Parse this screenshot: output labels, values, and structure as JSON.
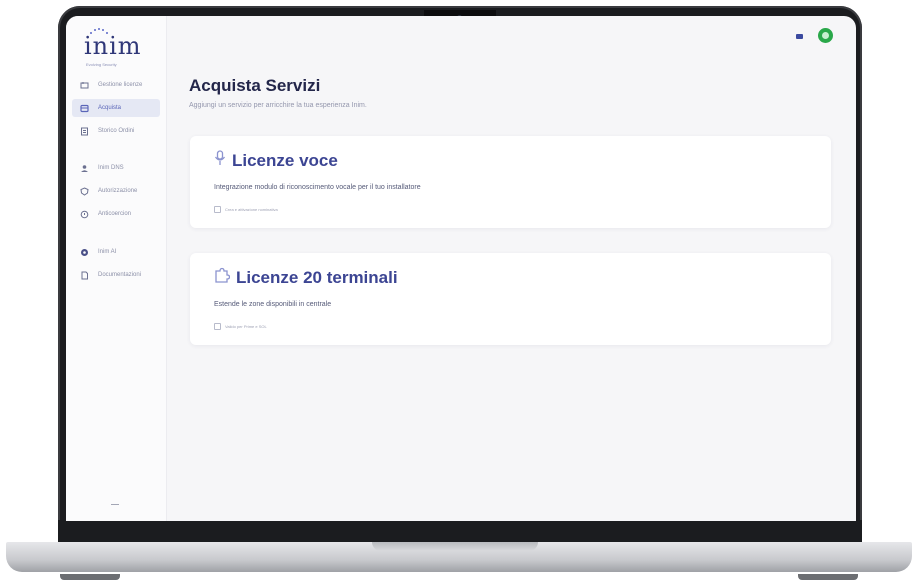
{
  "app": {
    "logo": "inim",
    "logo_tagline": "Evolving Security"
  },
  "sidebar": {
    "items": [
      {
        "label": "Gestione licenze",
        "icon": "license-icon",
        "active": false
      },
      {
        "label": "Acquista",
        "icon": "cart-icon",
        "active": true
      },
      {
        "label": "Storico Ordini",
        "icon": "orders-icon",
        "active": false
      },
      {
        "label": "Inim DNS",
        "icon": "users-icon",
        "active": false
      },
      {
        "label": "Autorizzazione",
        "icon": "shield-icon",
        "active": false
      },
      {
        "label": "Anticoercion",
        "icon": "alert-icon",
        "active": false
      },
      {
        "label": "Inim AI",
        "icon": "ai-icon",
        "active": false
      },
      {
        "label": "Documentazioni",
        "icon": "document-icon",
        "active": false
      }
    ]
  },
  "topbar": {
    "flag_icon": "flag-icon",
    "avatar_color": "#2aa84a"
  },
  "main": {
    "title": "Acquista Servizi",
    "subtitle": "Aggiungi un servizio per arricchire la tua esperienza Inim."
  },
  "cards": [
    {
      "icon": "microphone-icon",
      "title": "Licenze voce",
      "description": "Integrazione modulo di riconoscimento vocale per il tuo installatore",
      "note": "Crea e attivazione nominativa"
    },
    {
      "icon": "puzzle-icon",
      "title": "Licenze 20 terminali",
      "description": "Estende le zone disponibili in centrale",
      "note": "Valido per Prime e SOL"
    }
  ],
  "colors": {
    "accent": "#3c4593",
    "active_nav_bg": "#e5e8f4",
    "status_green": "#2aa84a"
  }
}
